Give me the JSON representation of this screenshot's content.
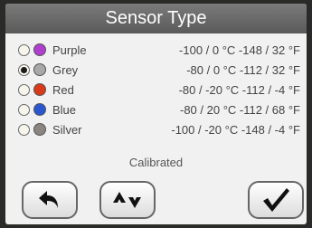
{
  "title": "Sensor Type",
  "sensors": [
    {
      "name": "Purple",
      "color": "#b03fd0",
      "range": "-100 / 0 °C -148 / 32 °F",
      "selected": false
    },
    {
      "name": "Grey",
      "color": "#a8a8a8",
      "range": "-80 / 0 °C -112 / 32 °F",
      "selected": true
    },
    {
      "name": "Red",
      "color": "#d83a1a",
      "range": "-80 / -20 °C -112 / -4 °F",
      "selected": false
    },
    {
      "name": "Blue",
      "color": "#2a56d0",
      "range": "-80 / 20 °C -112 / 68 °F",
      "selected": false
    },
    {
      "name": "Silver",
      "color": "#8a8580",
      "range": "-100 / -20 °C -148 / -4 °F",
      "selected": false
    }
  ],
  "status": "Calibrated",
  "buttons": {
    "back": "back-arrow-icon",
    "sort": "up-down-arrows-icon",
    "confirm": "checkmark-icon"
  }
}
